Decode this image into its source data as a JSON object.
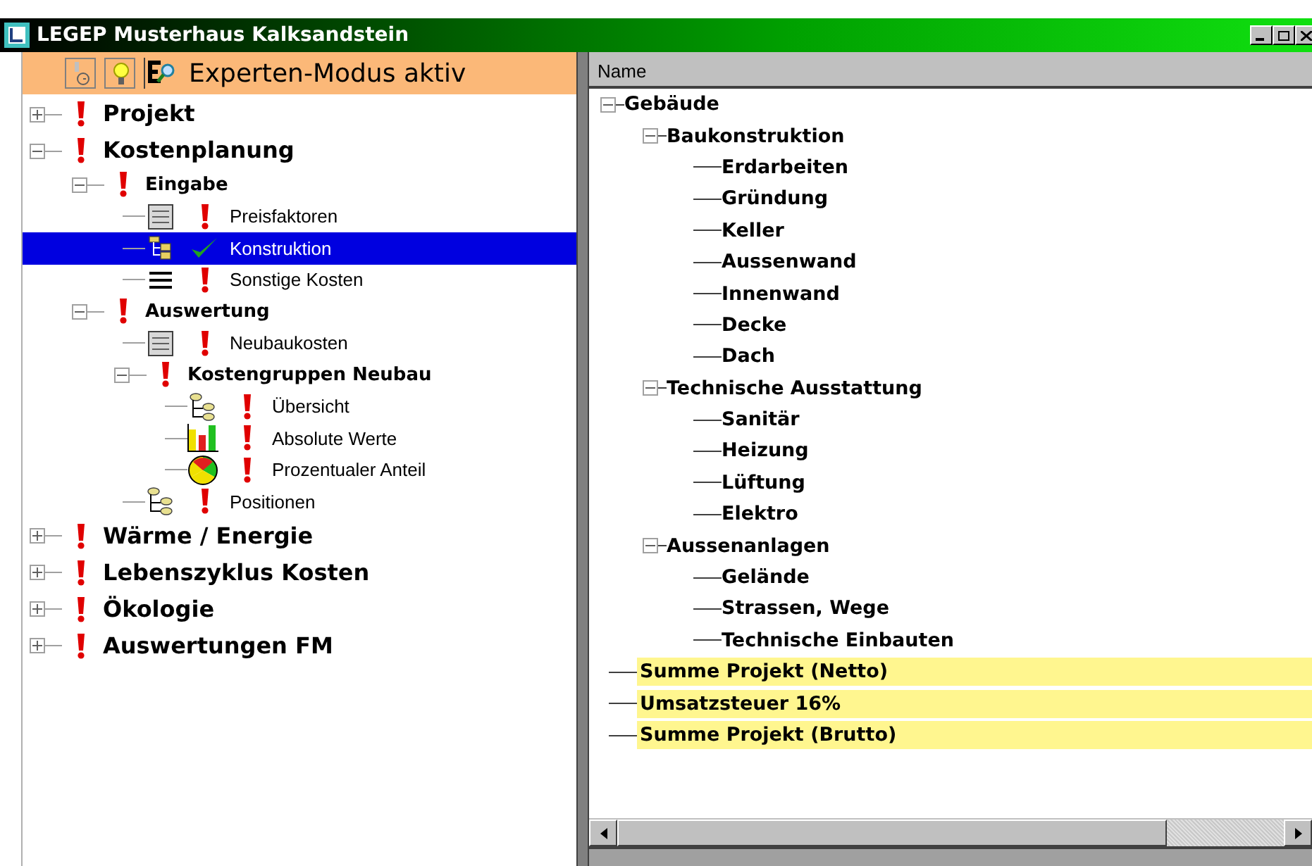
{
  "window": {
    "title": "LEGEP  Musterhaus Kalksandstein"
  },
  "mode_bar": {
    "label": "Experten-Modus aktiv"
  },
  "nav_tree": [
    {
      "label": "Projekt",
      "done": false,
      "expanded": false
    },
    {
      "label": "Kostenplanung",
      "done": false,
      "expanded": true,
      "children": [
        {
          "label": "Eingabe",
          "done": false,
          "expanded": true,
          "children": [
            {
              "label": "Preisfaktoren",
              "done": false,
              "kind": "form",
              "selected": false
            },
            {
              "label": "Konstruktion",
              "done": true,
              "kind": "folders",
              "selected": true
            },
            {
              "label": "Sonstige Kosten",
              "done": false,
              "kind": "list",
              "selected": false
            }
          ]
        },
        {
          "label": "Auswertung",
          "done": false,
          "expanded": true,
          "children": [
            {
              "label": "Neubaukosten",
              "done": false,
              "kind": "form",
              "selected": false
            },
            {
              "label": "Kostengruppen Neubau",
              "done": false,
              "expanded": true,
              "children": [
                {
                  "label": "Übersicht",
                  "done": false,
                  "kind": "nodes",
                  "selected": false
                },
                {
                  "label": "Absolute Werte",
                  "done": false,
                  "kind": "bars",
                  "selected": false
                },
                {
                  "label": "Prozentualer Anteil",
                  "done": false,
                  "kind": "pie",
                  "selected": false
                }
              ]
            },
            {
              "label": "Positionen",
              "done": false,
              "kind": "nodes",
              "selected": false
            }
          ]
        }
      ]
    },
    {
      "label": "Wärme / Energie",
      "done": false,
      "expanded": false
    },
    {
      "label": "Lebenszyklus Kosten",
      "done": false,
      "expanded": false
    },
    {
      "label": "Ökologie",
      "done": false,
      "expanded": false
    },
    {
      "label": "Auswertungen FM",
      "done": false,
      "expanded": false
    }
  ],
  "cost_tree": {
    "column": "Name",
    "items": [
      {
        "label": "Gebäude",
        "expanded": true,
        "children": [
          {
            "label": "Baukonstruktion",
            "expanded": true,
            "children": [
              {
                "label": "Erdarbeiten"
              },
              {
                "label": "Gründung"
              },
              {
                "label": "Keller"
              },
              {
                "label": "Aussenwand"
              },
              {
                "label": "Innenwand"
              },
              {
                "label": "Decke"
              },
              {
                "label": "Dach"
              }
            ]
          },
          {
            "label": "Technische Ausstattung",
            "expanded": true,
            "children": [
              {
                "label": "Sanitär"
              },
              {
                "label": "Heizung"
              },
              {
                "label": "Lüftung"
              },
              {
                "label": "Elektro"
              }
            ]
          },
          {
            "label": "Aussenanlagen",
            "expanded": true,
            "children": [
              {
                "label": "Gelände"
              },
              {
                "label": "Strassen, Wege"
              },
              {
                "label": "Technische Einbauten"
              }
            ]
          }
        ]
      },
      {
        "label": "Summe Projekt (Netto)",
        "highlighted": true
      },
      {
        "label": "Umsatzsteuer 16%",
        "highlighted": true
      },
      {
        "label": "Summe Projekt (Brutto)",
        "highlighted": true
      }
    ]
  }
}
